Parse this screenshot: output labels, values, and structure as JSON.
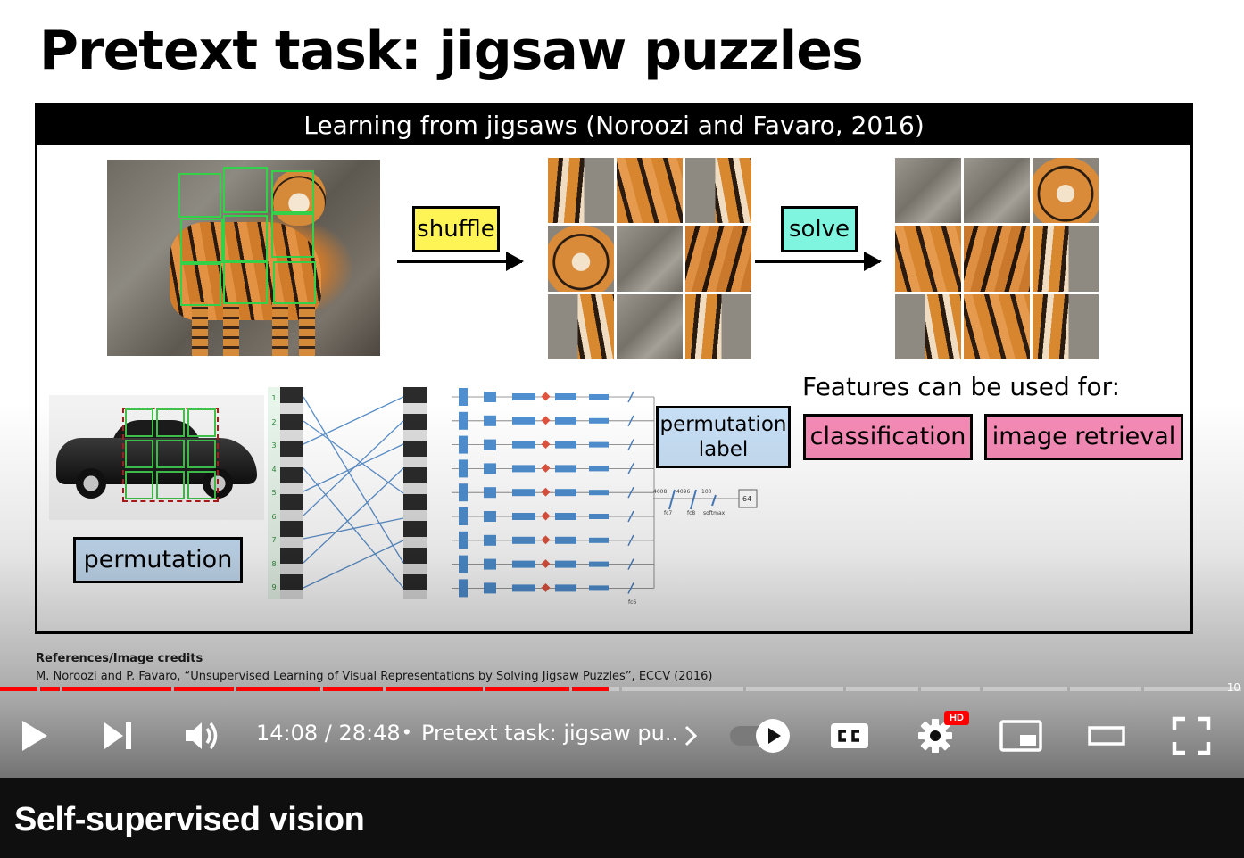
{
  "slide": {
    "title": "Pretext task: jigsaw puzzles",
    "figure_header": "Learning from jigsaws (Noroozi and Favaro, 2016)",
    "labels": {
      "shuffle": "shuffle",
      "solve": "solve",
      "permutation": "permutation",
      "permutation_label_line1": "permutation",
      "permutation_label_line2": "label",
      "features_title": "Features can be used for:",
      "classification": "classification",
      "image_retrieval": "image retrieval"
    },
    "network": {
      "numbers": [
        "1",
        "2",
        "3",
        "4",
        "5",
        "6",
        "7",
        "8",
        "9"
      ],
      "dims": [
        "4608",
        "4096",
        "100"
      ],
      "output": "64",
      "layer_names": [
        "fc7",
        "fc8",
        "softmax"
      ],
      "fc6": "fc6"
    },
    "references_heading": "References/Image credits",
    "reference": "M. Noroozi and P. Favaro, “Unsupervised Learning of Visual Representations by Solving Jigsaw Puzzles”, ECCV (2016)"
  },
  "player": {
    "time_current": "14:08",
    "time_total": "28:48",
    "time_separator": " / ",
    "chapter_title": "Pretext task: jigsaw pu...",
    "chapter_count": "10",
    "hd_badge": "HD",
    "progress_fraction": 0.489,
    "icons": [
      "play-icon",
      "next-icon",
      "volume-icon",
      "chevron-right-icon",
      "autoplay-toggle",
      "captions-icon",
      "settings-icon",
      "miniplayer-icon",
      "theater-icon",
      "fullscreen-icon"
    ],
    "colors": {
      "played": "#ff0000",
      "hd": "#ff0000"
    }
  },
  "video": {
    "title": "Self-supervised vision"
  }
}
